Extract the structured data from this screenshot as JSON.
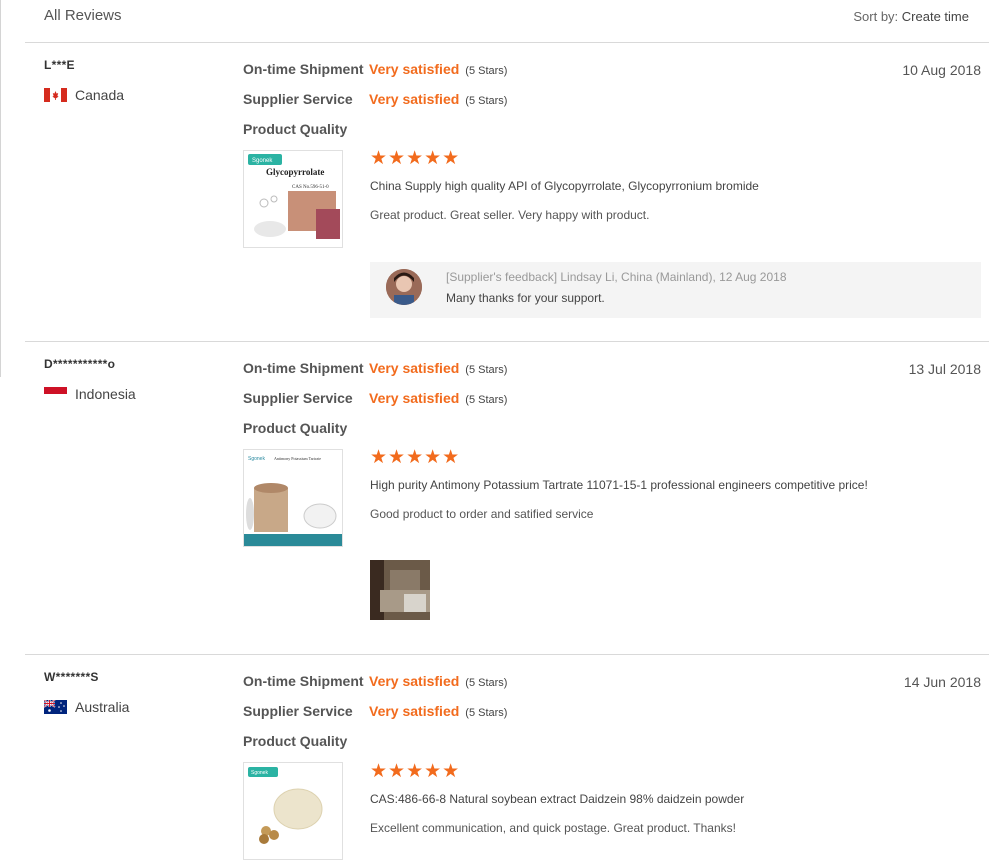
{
  "header": {
    "title": "All Reviews",
    "sort_label": "Sort by:",
    "sort_value": "Create time"
  },
  "colors": {
    "accent": "#f26b1d",
    "divider": "#d9d9d9"
  },
  "reviews": [
    {
      "buyer": "L***E",
      "country": "Canada",
      "flag_icon": "canada-flag-icon",
      "date": "10 Aug 2018",
      "ratings": [
        {
          "label": "On-time Shipment",
          "value": "Very satisfied",
          "stars": "(5 Stars)"
        },
        {
          "label": "Supplier Service",
          "value": "Very satisfied",
          "stars": "(5 Stars)"
        },
        {
          "label": "Product Quality"
        }
      ],
      "product_stars": 5,
      "product_name": "China Supply high quality API of Glycopyrrolate, Glycopyrronium bromide",
      "review_text": "Great product. Great seller. Very happy with product.",
      "thumb_caption": "Glycopyrrolate",
      "thumb_cas": "CAS No.596-51-0",
      "feedback": {
        "meta": "[Supplier's feedback] Lindsay Li, China (Mainland), 12 Aug 2018",
        "text": "Many thanks for your support."
      }
    },
    {
      "buyer": "D***********o",
      "country": "Indonesia",
      "flag_icon": "indonesia-flag-icon",
      "date": "13 Jul 2018",
      "ratings": [
        {
          "label": "On-time Shipment",
          "value": "Very satisfied",
          "stars": "(5 Stars)"
        },
        {
          "label": "Supplier Service",
          "value": "Very satisfied",
          "stars": "(5 Stars)"
        },
        {
          "label": "Product Quality"
        }
      ],
      "product_stars": 5,
      "product_name": "High purity Antimony Potassium Tartrate 11071-15-1 professional engineers competitive price!",
      "review_text": "Good product to order and satified service",
      "thumb_caption": "Antimony Potassium Tartrate"
    },
    {
      "buyer": "W*******S",
      "country": "Australia",
      "flag_icon": "australia-flag-icon",
      "date": "14 Jun 2018",
      "ratings": [
        {
          "label": "On-time Shipment",
          "value": "Very satisfied",
          "stars": "(5 Stars)"
        },
        {
          "label": "Supplier Service",
          "value": "Very satisfied",
          "stars": "(5 Stars)"
        },
        {
          "label": "Product Quality"
        }
      ],
      "product_stars": 5,
      "product_name": "CAS:486-66-8 Natural soybean extract Daidzein 98% daidzein powder",
      "review_text": "Excellent communication, and quick postage. Great product. Thanks!"
    }
  ]
}
